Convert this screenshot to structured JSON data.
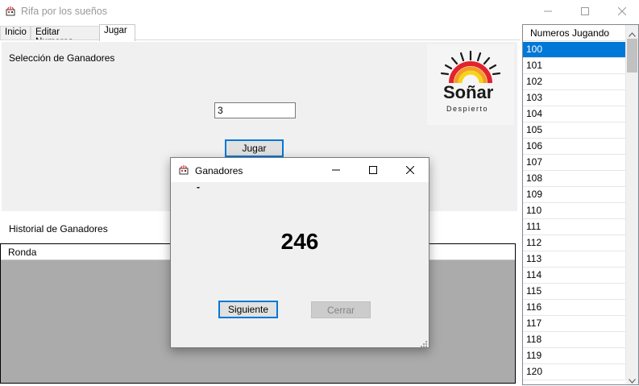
{
  "window": {
    "title": "Rifa por los sueños",
    "app_icon": "raffle-app-icon",
    "controls": [
      "minimize-icon",
      "maximize-icon",
      "close-icon"
    ]
  },
  "tabs": [
    {
      "label": "Inicio",
      "active": false
    },
    {
      "label": "Editar Numeros",
      "active": false
    },
    {
      "label": "Jugar",
      "active": true
    }
  ],
  "selection": {
    "heading": "Selección de Ganadores",
    "count_value": "3",
    "play_button": "Jugar"
  },
  "logo": {
    "brand": "Soñar",
    "tagline": "Despierto",
    "colors": {
      "black": "#1a1a1a",
      "red": "#e3232b",
      "orange": "#f39c28",
      "yellow": "#f7d417"
    }
  },
  "history": {
    "heading": "Historial de Ganadores",
    "column": "Ronda"
  },
  "numbers_list": {
    "header": "Numeros Jugando",
    "items": [
      "100",
      "101",
      "102",
      "103",
      "104",
      "105",
      "106",
      "107",
      "108",
      "109",
      "110",
      "111",
      "112",
      "113",
      "114",
      "115",
      "116",
      "117",
      "118",
      "119",
      "120"
    ],
    "selected": "100"
  },
  "dialog": {
    "title": "Ganadores",
    "dash": "-",
    "number": "246",
    "next_button": "Siguiente",
    "close_button": "Cerrar"
  },
  "colors": {
    "accent": "#0078d7",
    "panel": "#f0f0f0",
    "grid_bg": "#ababab"
  }
}
